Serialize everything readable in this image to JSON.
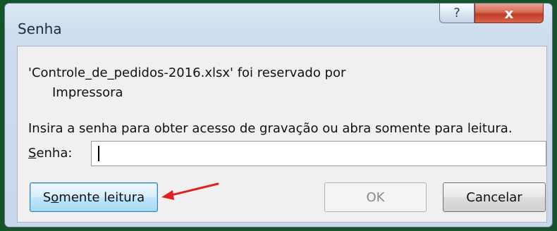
{
  "window": {
    "title": "Senha",
    "help_glyph": "?",
    "close_glyph": "x"
  },
  "message": {
    "line1": "'Controle_de_pedidos-2016.xlsx' foi reservado por",
    "line2": "Impressora",
    "instruction": "Insira a senha para obter acesso de gravação ou abra somente para leitura."
  },
  "password": {
    "label_mnemonic": "S",
    "label_rest": "enha:",
    "value": ""
  },
  "buttons": {
    "readonly_before": "S",
    "readonly_mnemonic": "o",
    "readonly_after": "mente leitura",
    "ok": "OK",
    "cancel": "Cancelar"
  },
  "colors": {
    "annotation_arrow": "#e02020"
  },
  "icons": {
    "help": "help-icon",
    "close": "close-icon",
    "annotation": "red-arrow-annotation"
  }
}
